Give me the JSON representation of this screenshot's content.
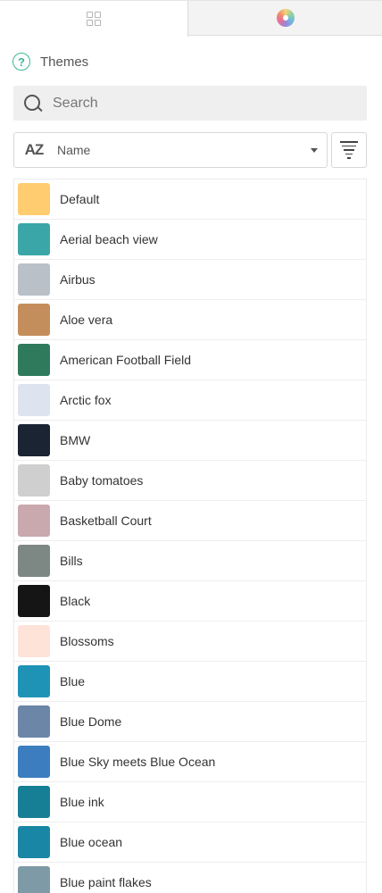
{
  "tabs": [
    {
      "icon": "grid-icon"
    },
    {
      "icon": "color-wheel-icon"
    }
  ],
  "themes_label": "Themes",
  "search": {
    "placeholder": "Search"
  },
  "sort": {
    "label": "Name"
  },
  "items": [
    {
      "label": "Default",
      "color": "#ffcc70"
    },
    {
      "label": "Aerial beach view",
      "color": "#3aa6a8"
    },
    {
      "label": "Airbus",
      "color": "#b9c0c8"
    },
    {
      "label": "Aloe vera",
      "color": "#c48e5c"
    },
    {
      "label": "American Football Field",
      "color": "#2f7a5c"
    },
    {
      "label": "Arctic fox",
      "color": "#dde4ef"
    },
    {
      "label": "BMW",
      "color": "#1b2433"
    },
    {
      "label": "Baby tomatoes",
      "color": "#cfcfcf"
    },
    {
      "label": "Basketball Court",
      "color": "#c9a9ae"
    },
    {
      "label": "Bills",
      "color": "#7d8783"
    },
    {
      "label": "Black",
      "color": "#151515"
    },
    {
      "label": "Blossoms",
      "color": "#fde3d8"
    },
    {
      "label": "Blue",
      "color": "#1f93b5"
    },
    {
      "label": "Blue Dome",
      "color": "#6b86a6"
    },
    {
      "label": "Blue Sky meets Blue Ocean",
      "color": "#3b7dbe"
    },
    {
      "label": "Blue ink",
      "color": "#167f96"
    },
    {
      "label": "Blue ocean",
      "color": "#1a86a6"
    },
    {
      "label": "Blue paint flakes",
      "color": "#7e9aa6"
    }
  ]
}
